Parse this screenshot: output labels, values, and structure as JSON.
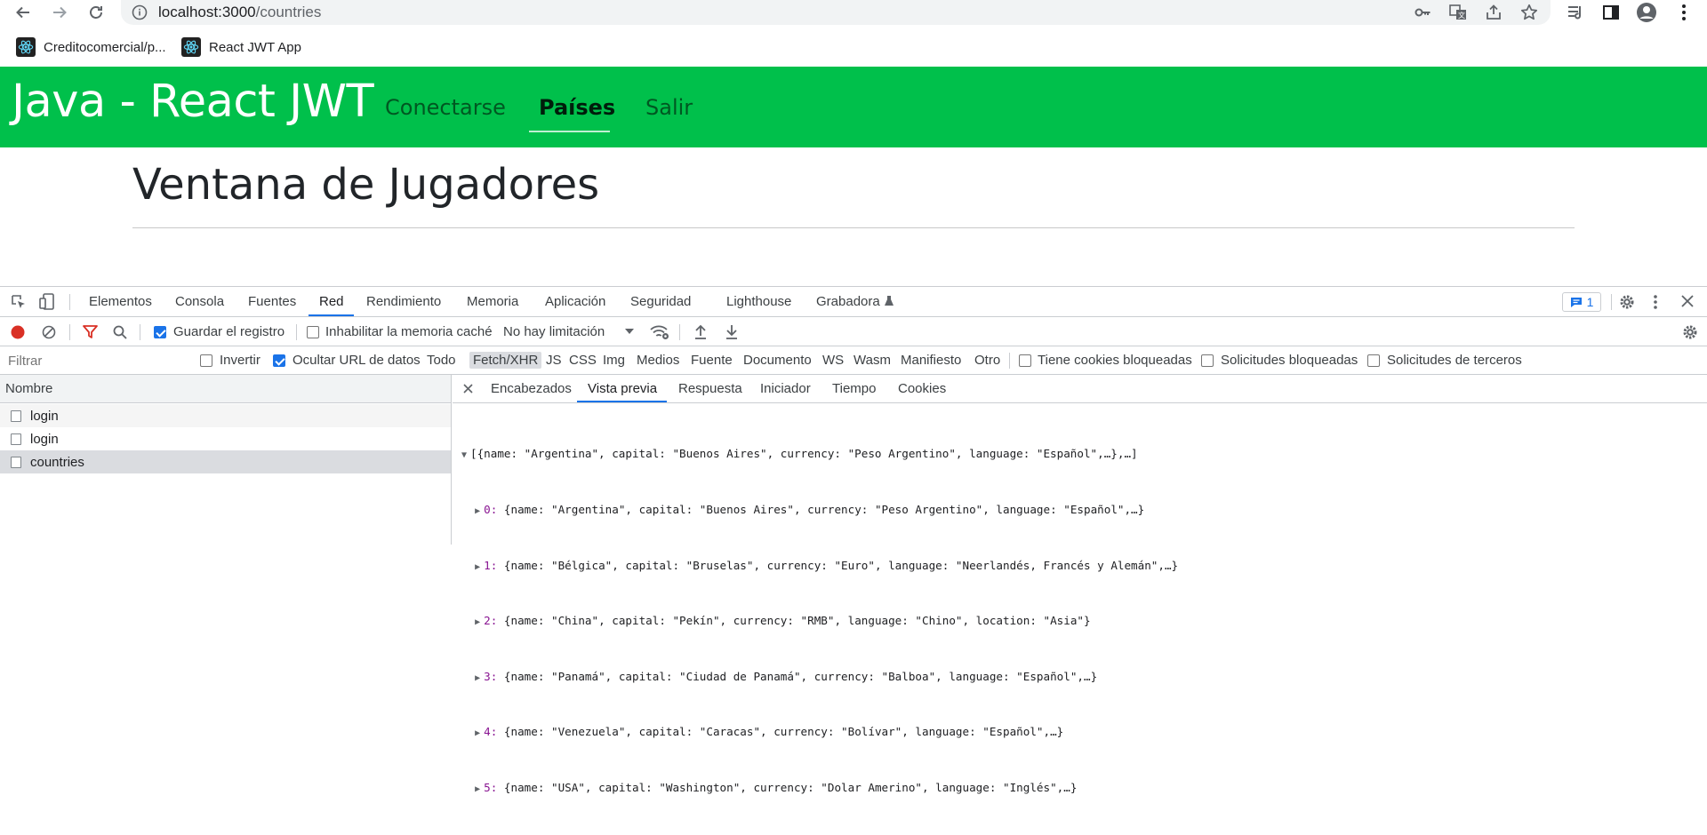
{
  "browser": {
    "url_host": "localhost:3000",
    "url_path": "/countries",
    "bookmarks": [
      "Creditocomercial/p...",
      "React JWT App"
    ]
  },
  "app": {
    "brand": "Java - React JWT",
    "nav": [
      "Conectarse",
      "Países",
      "Salir"
    ],
    "active_nav": "Países",
    "page_title": "Ventana de Jugadores",
    "colors": {
      "navbar": "#00c04b"
    }
  },
  "devtools": {
    "tabs": [
      "Elementos",
      "Consola",
      "Fuentes",
      "Red",
      "Rendimiento",
      "Memoria",
      "Aplicación",
      "Seguridad",
      "Lighthouse",
      "Grabadora"
    ],
    "active_tab": "Red",
    "messages_count": "1",
    "toolbar": {
      "preserve_log": "Guardar el registro",
      "disable_cache": "Inhabilitar la memoria caché",
      "throttling": "No hay limitación"
    },
    "filter": {
      "placeholder": "Filtrar",
      "invert": "Invertir",
      "hide_data_urls": "Ocultar URL de datos",
      "types": [
        "Todo",
        "Fetch/XHR",
        "JS",
        "CSS",
        "Img",
        "Medios",
        "Fuente",
        "Documento",
        "WS",
        "Wasm",
        "Manifiesto",
        "Otro"
      ],
      "selected_type": "Fetch/XHR",
      "blocked_cookies": "Tiene cookies bloqueadas",
      "blocked_requests": "Solicitudes bloqueadas",
      "third_party": "Solicitudes de terceros"
    },
    "requests": {
      "header": "Nombre",
      "rows": [
        "login",
        "login",
        "countries"
      ]
    },
    "detail_tabs": [
      "Encabezados",
      "Vista previa",
      "Respuesta",
      "Iniciador",
      "Tiempo",
      "Cookies"
    ],
    "active_detail_tab": "Vista previa",
    "preview": {
      "root": "[{name: \"Argentina\", capital: \"Buenos Aires\", currency: \"Peso Argentino\", language: \"Español\",…},…]",
      "items": [
        {
          "index": "0:",
          "text": " {name: \"Argentina\", capital: \"Buenos Aires\", currency: \"Peso Argentino\", language: \"Español\",…}"
        },
        {
          "index": "1:",
          "text": " {name: \"Bélgica\", capital: \"Bruselas\", currency: \"Euro\", language: \"Neerlandés, Francés y Alemán\",…}"
        },
        {
          "index": "2:",
          "text": " {name: \"China\", capital: \"Pekín\", currency: \"RMB\", language: \"Chino\", location: \"Asia\"}"
        },
        {
          "index": "3:",
          "text": " {name: \"Panamá\", capital: \"Ciudad de Panamá\", currency: \"Balboa\", language: \"Español\",…}"
        },
        {
          "index": "4:",
          "text": " {name: \"Venezuela\", capital: \"Caracas\", currency: \"Bolívar\", language: \"Español\",…}"
        },
        {
          "index": "5:",
          "text": " {name: \"USA\", capital: \"Washington\", currency: \"Dolar Amerino\", language: \"Inglés\",…}"
        }
      ]
    }
  }
}
